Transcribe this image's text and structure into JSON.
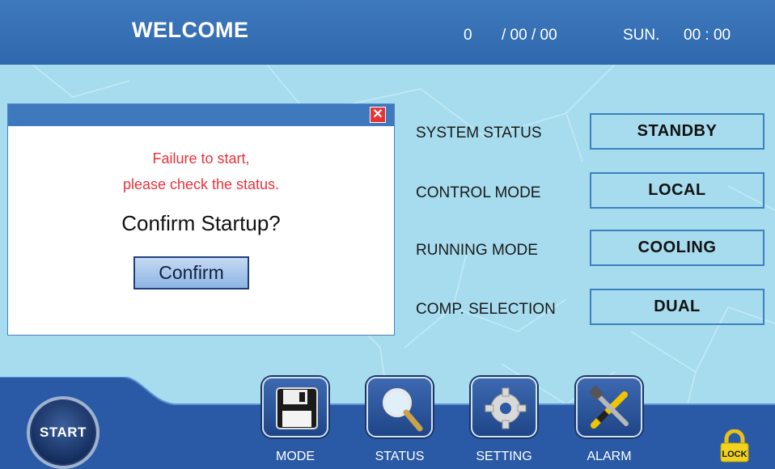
{
  "header": {
    "title": "WELCOME",
    "date_year": "0",
    "date_month_day": "/ 00 / 00",
    "day_of_week": "SUN.",
    "time": "00 : 00"
  },
  "dialog": {
    "close_glyph": "✕",
    "message_line1": "Failure to start,",
    "message_line2": "please check the status.",
    "question": "Confirm Startup?",
    "confirm_label": "Confirm"
  },
  "status": [
    {
      "label": "SYSTEM STATUS",
      "value": "STANDBY"
    },
    {
      "label": "CONTROL MODE",
      "value": "LOCAL"
    },
    {
      "label": "RUNNING MODE",
      "value": "COOLING"
    },
    {
      "label": "COMP. SELECTION",
      "value": "DUAL"
    }
  ],
  "nav": {
    "start_label": "START",
    "items": [
      {
        "label": "MODE",
        "icon": "floppy-disk-icon"
      },
      {
        "label": "STATUS",
        "icon": "magnifier-icon"
      },
      {
        "label": "SETTING",
        "icon": "gear-icon"
      },
      {
        "label": "ALARM",
        "icon": "tools-icon"
      }
    ],
    "lock_label": "LOCK"
  },
  "colors": {
    "header_blue": "#3f79bd",
    "background": "#a6dcee",
    "alert_red": "#e8323c",
    "panel_dark_blue": "#2a5aa5"
  }
}
